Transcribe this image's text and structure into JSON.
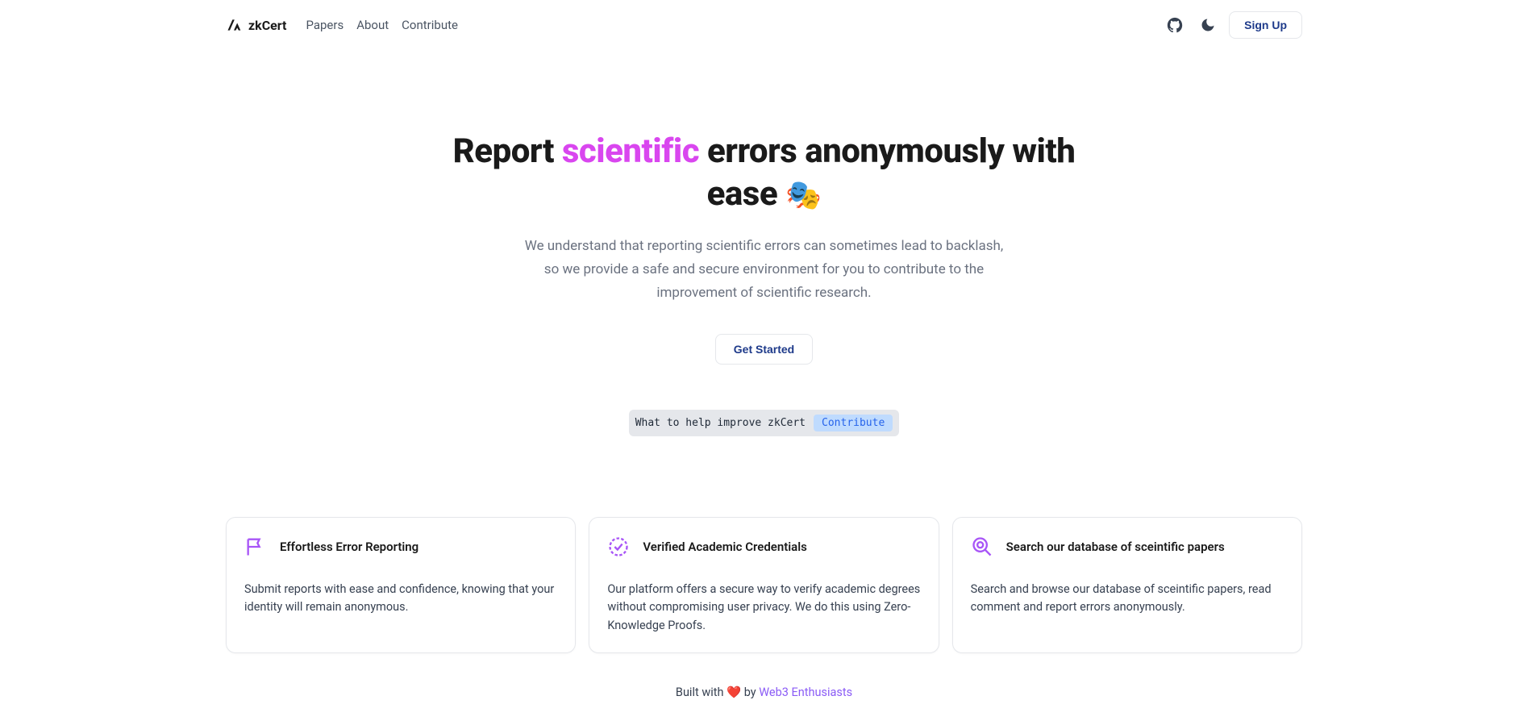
{
  "brand": "zkCert",
  "nav": {
    "links": [
      "Papers",
      "About",
      "Contribute"
    ],
    "signup": "Sign Up"
  },
  "hero": {
    "title_pre": "Report ",
    "title_accent": "scientific",
    "title_post": " errors anonymously with ease ",
    "emoji": "🎭",
    "subtitle": "We understand that reporting scientific errors can sometimes lead to backlash, so we provide a safe and secure environment for you to contribute to the improvement of scientific research.",
    "cta": "Get Started"
  },
  "banner": {
    "text": "What to help improve zkCert",
    "pill": "Contribute"
  },
  "features": [
    {
      "title": "Effortless Error Reporting",
      "body": "Submit reports with ease and confidence, knowing that your identity will remain anonymous."
    },
    {
      "title": "Verified Academic Credentials",
      "body": "Our platform offers a secure way to verify academic degrees without compromising user privacy. We do this using Zero-Knowledge Proofs."
    },
    {
      "title": "Search our database of sceintific papers",
      "body": "Search and browse our database of sceintific papers, read comment and report errors anonymously."
    }
  ],
  "footer": {
    "pre": "Built with ",
    "heart": "❤️",
    "mid": " by ",
    "link": "Web3 Enthusiasts"
  }
}
